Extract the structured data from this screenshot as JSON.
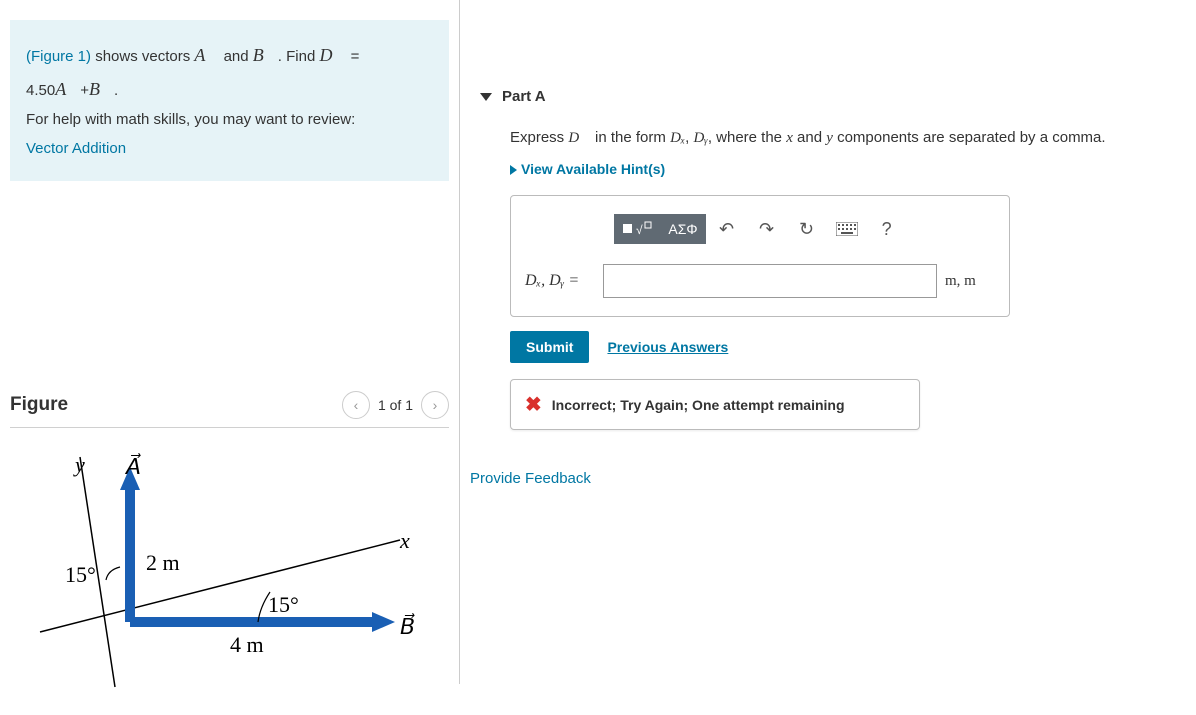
{
  "problem": {
    "figure_ref": "(Figure 1)",
    "text1": " shows vectors ",
    "vecA": "A⃗",
    "and": " and ",
    "vecB": "B⃗",
    "text2": ". Find ",
    "vecD": "D⃗",
    "eq": " = 4.50",
    "vecA2": "A⃗",
    "plus": "+",
    "vecB2": "B⃗",
    "period": ".",
    "help_text": "For help with math skills, you may want to review:",
    "link_text": "Vector Addition"
  },
  "figure": {
    "title": "Figure",
    "nav_label": "1 of 1",
    "y_label": "y",
    "x_label": "x",
    "A_label": "A⃗",
    "B_label": "B⃗",
    "A_len": "2 m",
    "B_len": "4 m",
    "angle1": "15°",
    "angle2": "15°"
  },
  "part": {
    "title": "Part A",
    "instruction_pre": "Express ",
    "instruction_vec": "D⃗",
    "instruction_mid": " in the form ",
    "Dx": "Dₓ",
    "comma": ", ",
    "Dy": "Dᵧ",
    "instruction_post": ", where the ",
    "x_var": "x",
    "and2": " and ",
    "y_var": "y",
    "instruction_end": " components are separated by a comma.",
    "hints": "View Available Hint(s)",
    "toolbar": {
      "templates": "▪√[]",
      "greek": "ΑΣΦ",
      "undo": "↶",
      "redo": "↷",
      "reset": "↻",
      "keyboard": "⌨",
      "help": "?"
    },
    "answer_label": "Dₓ, Dᵧ =",
    "answer_value": "",
    "unit": "m, m",
    "submit": "Submit",
    "prev": "Previous Answers",
    "feedback": "Incorrect; Try Again; One attempt remaining"
  },
  "provide_feedback": "Provide Feedback"
}
